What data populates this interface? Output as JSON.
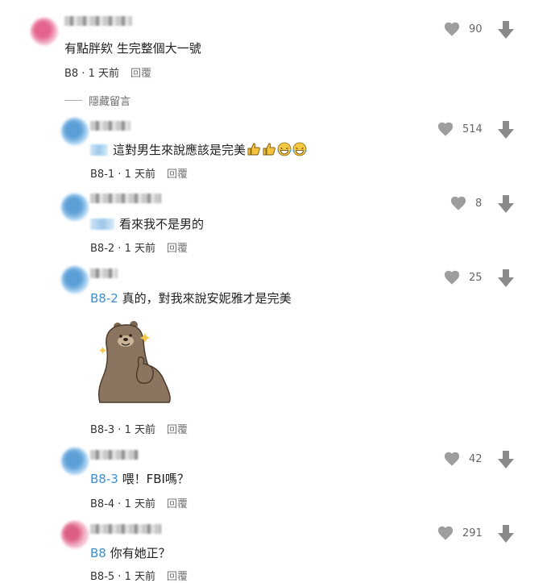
{
  "labels": {
    "hide_replies": "隱藏留言",
    "reply": "回覆"
  },
  "comments": [
    {
      "text": "有點胖欸 生完整個大一號",
      "floor": "B8",
      "time": "1 天前",
      "likes": "90"
    },
    {
      "text": "這對男生來說應該是完美",
      "floor": "B8-1",
      "time": "1 天前",
      "likes": "514",
      "emoji_after": [
        "thumbs-up-icon",
        "thumbs-up-icon",
        "laughing-face-icon",
        "laughing-face-icon"
      ]
    },
    {
      "text": "看來我不是男的",
      "floor": "B8-2",
      "time": "1 天前",
      "likes": "8"
    },
    {
      "mention": "B8-2",
      "text": "真的，對我來說安妮雅才是完美",
      "floor": "B8-3",
      "time": "1 天前",
      "likes": "25",
      "sticker": "bear-thumbs-up-sticker"
    },
    {
      "mention": "B8-3",
      "text": "喂！FBI嗎？",
      "floor": "B8-4",
      "time": "1 天前",
      "likes": "42"
    },
    {
      "mention": "B8",
      "text": "你有她正？",
      "floor": "B8-5",
      "time": "1 天前",
      "likes": "291"
    }
  ],
  "colors": {
    "mention": "#3e8ecf",
    "icon": "#9e9e9e"
  }
}
